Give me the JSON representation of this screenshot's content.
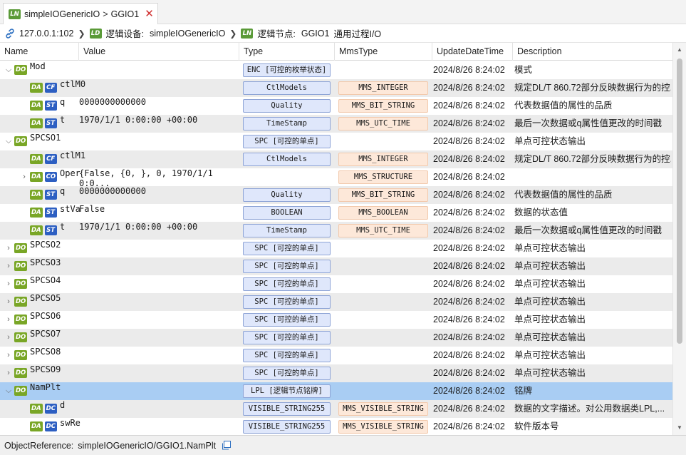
{
  "tab": {
    "badge": "LN",
    "parent": "simpleIOGenericIO",
    "separator": ">",
    "name": "GGIO1",
    "close": "✕"
  },
  "breadcrumb": {
    "host": "127.0.0.1:102",
    "device_badge": "LD",
    "device_label": "逻辑设备:",
    "device_name": "simpleIOGenericIO",
    "node_badge": "LN",
    "node_label": "逻辑节点:",
    "node_name": "GGIO1",
    "node_desc": "通用过程I/O"
  },
  "columns": {
    "name": "Name",
    "value": "Value",
    "type": "Type",
    "mms": "MmsType",
    "date": "UpdateDateTime",
    "desc": "Description"
  },
  "rows": [
    {
      "twisty": "open",
      "tags": [
        "DO"
      ],
      "name": "Mod",
      "value": "",
      "type": "ENC [可控的枚举状态]",
      "mms": "",
      "date": "2024/8/26 8:24:02",
      "desc": "模式"
    },
    {
      "twisty": "",
      "tags": [
        "DA",
        "CF"
      ],
      "name": "ctlM0",
      "value": "",
      "type": "CtlModels",
      "mms": "MMS_INTEGER",
      "date": "2024/8/26 8:24:02",
      "desc": "规定DL/T 860.72部分反映数据行为的控..."
    },
    {
      "twisty": "",
      "tags": [
        "DA",
        "ST"
      ],
      "name": "q",
      "value": "0000000000000",
      "type": "Quality",
      "mms": "MMS_BIT_STRING",
      "date": "2024/8/26 8:24:02",
      "desc": "代表数据值的属性的品质"
    },
    {
      "twisty": "",
      "tags": [
        "DA",
        "ST"
      ],
      "name": "t",
      "value": "1970/1/1 0:00:00 +00:00",
      "type": "TimeStamp",
      "mms": "MMS_UTC_TIME",
      "date": "2024/8/26 8:24:02",
      "desc": "最后一次数据或q属性值更改的时间戳"
    },
    {
      "twisty": "open",
      "tags": [
        "DO"
      ],
      "name": "SPCSO1",
      "value": "",
      "type": "SPC [可控的单点]",
      "mms": "",
      "date": "2024/8/26 8:24:02",
      "desc": "单点可控状态输出"
    },
    {
      "twisty": "",
      "tags": [
        "DA",
        "CF"
      ],
      "name": "ctlM1",
      "value": "",
      "type": "CtlModels",
      "mms": "MMS_INTEGER",
      "date": "2024/8/26 8:24:02",
      "desc": "规定DL/T 860.72部分反映数据行为的控..."
    },
    {
      "twisty": "closed",
      "tags": [
        "DA",
        "CO"
      ],
      "name": "Oper",
      "value": "{False, {0, }, 0, 1970/1/1 0:0...",
      "type": "",
      "mms": "MMS_STRUCTURE",
      "date": "2024/8/26 8:24:02",
      "desc": ""
    },
    {
      "twisty": "",
      "tags": [
        "DA",
        "ST"
      ],
      "name": "q",
      "value": "0000000000000",
      "type": "Quality",
      "mms": "MMS_BIT_STRING",
      "date": "2024/8/26 8:24:02",
      "desc": "代表数据值的属性的品质"
    },
    {
      "twisty": "",
      "tags": [
        "DA",
        "ST"
      ],
      "name": "stVa",
      "value": "False",
      "type": "BOOLEAN",
      "mms": "MMS_BOOLEAN",
      "date": "2024/8/26 8:24:02",
      "desc": "数据的状态值"
    },
    {
      "twisty": "",
      "tags": [
        "DA",
        "ST"
      ],
      "name": "t",
      "value": "1970/1/1 0:00:00 +00:00",
      "type": "TimeStamp",
      "mms": "MMS_UTC_TIME",
      "date": "2024/8/26 8:24:02",
      "desc": "最后一次数据或q属性值更改的时间戳"
    },
    {
      "twisty": "closed",
      "tags": [
        "DO"
      ],
      "name": "SPCSO2",
      "value": "",
      "type": "SPC [可控的单点]",
      "mms": "",
      "date": "2024/8/26 8:24:02",
      "desc": "单点可控状态输出"
    },
    {
      "twisty": "closed",
      "tags": [
        "DO"
      ],
      "name": "SPCSO3",
      "value": "",
      "type": "SPC [可控的单点]",
      "mms": "",
      "date": "2024/8/26 8:24:02",
      "desc": "单点可控状态输出"
    },
    {
      "twisty": "closed",
      "tags": [
        "DO"
      ],
      "name": "SPCSO4",
      "value": "",
      "type": "SPC [可控的单点]",
      "mms": "",
      "date": "2024/8/26 8:24:02",
      "desc": "单点可控状态输出"
    },
    {
      "twisty": "closed",
      "tags": [
        "DO"
      ],
      "name": "SPCSO5",
      "value": "",
      "type": "SPC [可控的单点]",
      "mms": "",
      "date": "2024/8/26 8:24:02",
      "desc": "单点可控状态输出"
    },
    {
      "twisty": "closed",
      "tags": [
        "DO"
      ],
      "name": "SPCSO6",
      "value": "",
      "type": "SPC [可控的单点]",
      "mms": "",
      "date": "2024/8/26 8:24:02",
      "desc": "单点可控状态输出"
    },
    {
      "twisty": "closed",
      "tags": [
        "DO"
      ],
      "name": "SPCSO7",
      "value": "",
      "type": "SPC [可控的单点]",
      "mms": "",
      "date": "2024/8/26 8:24:02",
      "desc": "单点可控状态输出"
    },
    {
      "twisty": "closed",
      "tags": [
        "DO"
      ],
      "name": "SPCSO8",
      "value": "",
      "type": "SPC [可控的单点]",
      "mms": "",
      "date": "2024/8/26 8:24:02",
      "desc": "单点可控状态输出"
    },
    {
      "twisty": "closed",
      "tags": [
        "DO"
      ],
      "name": "SPCSO9",
      "value": "",
      "type": "SPC [可控的单点]",
      "mms": "",
      "date": "2024/8/26 8:24:02",
      "desc": "单点可控状态输出"
    },
    {
      "twisty": "open",
      "tags": [
        "DO"
      ],
      "name": "NamPlt",
      "value": "",
      "type": "LPL [逻辑节点铭牌]",
      "mms": "",
      "date": "2024/8/26 8:24:02",
      "desc": "铭牌",
      "selected": true
    },
    {
      "twisty": "",
      "tags": [
        "DA",
        "DC"
      ],
      "name": "d",
      "value": "",
      "type": "VISIBLE_STRING255",
      "mms": "MMS_VISIBLE_STRING",
      "date": "2024/8/26 8:24:02",
      "desc": "数据的文字描述。对公用数据类LPL,..."
    },
    {
      "twisty": "",
      "tags": [
        "DA",
        "DC"
      ],
      "name": "swRe",
      "value": "",
      "type": "VISIBLE_STRING255",
      "mms": "MMS_VISIBLE_STRING",
      "date": "2024/8/26 8:24:02",
      "desc": "软件版本号"
    }
  ],
  "status": {
    "label": "ObjectReference:",
    "reference": "simpleIOGenericIO/GGIO1.NamPlt"
  },
  "icons": {
    "tab_close": "close-icon",
    "host": "link-icon",
    "copy": "copy-icon"
  },
  "colors": {
    "selected_row": "#a9cdf3",
    "alt_row": "#ebebeb",
    "do_tag": "#79a626",
    "fc_tag": "#2d5fc2",
    "type_pill": "#dfe7fb",
    "mms_pill": "#fde8d9",
    "close": "#d03030"
  }
}
